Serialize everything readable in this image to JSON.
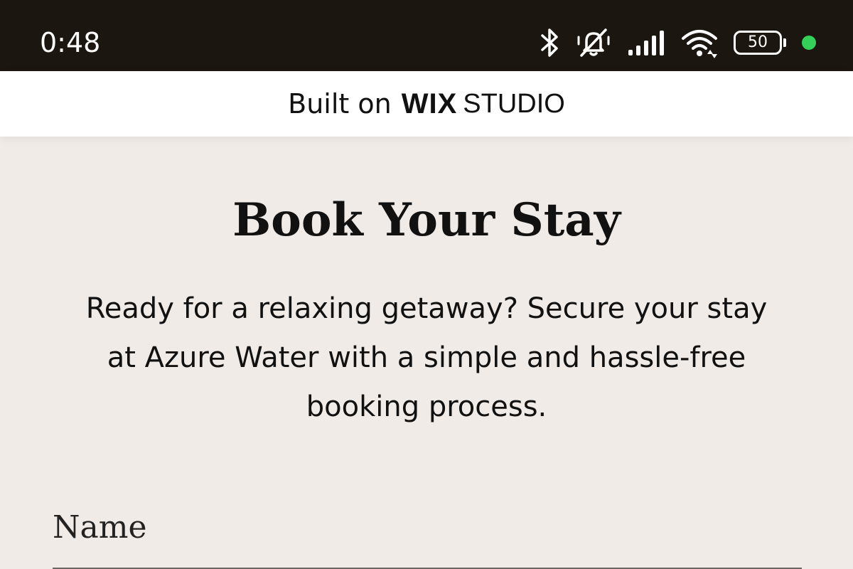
{
  "status_bar": {
    "time": "0:48",
    "battery_level": "50",
    "icons": [
      "bluetooth-icon",
      "muted-bell-icon",
      "signal-icon",
      "wifi-icon",
      "battery-icon",
      "active-dot"
    ],
    "dot_color": "#35d05a"
  },
  "banner": {
    "built_on": "Built on",
    "brand": "WIX",
    "product": "STUDIO"
  },
  "main": {
    "title": "Book Your Stay",
    "description": "Ready for a relaxing getaway? Secure your stay at Azure Water with a simple and hassle-free booking process.",
    "form": {
      "name_label": "Name",
      "name_value": ""
    }
  },
  "colors": {
    "page_background": "#f0ebe7",
    "status_bar_background": "#1b1610",
    "banner_background": "#ffffff"
  }
}
